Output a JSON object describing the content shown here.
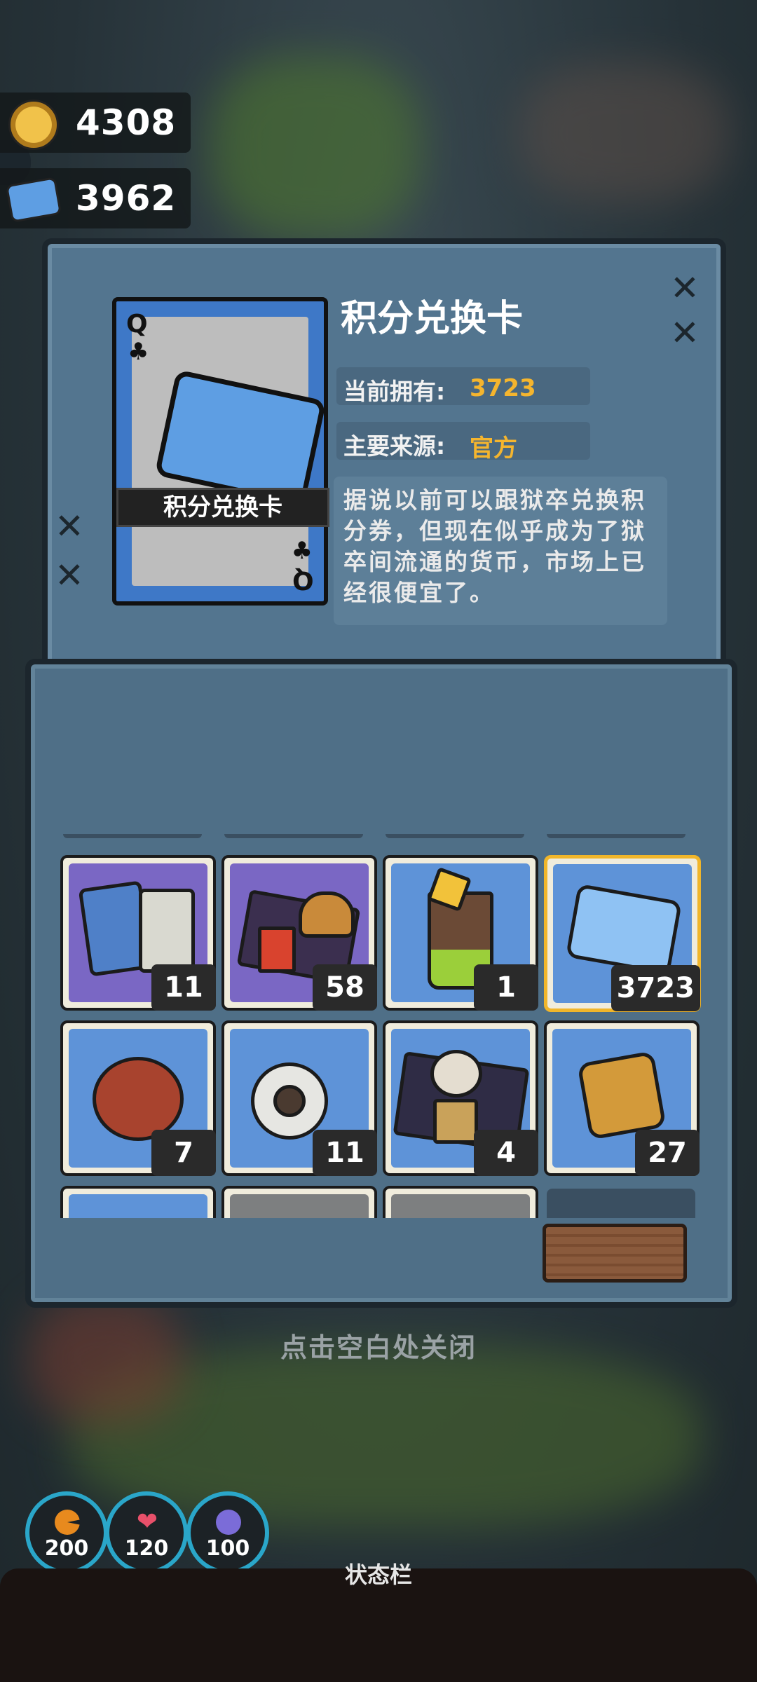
{
  "currency": {
    "coins": "4308",
    "tickets": "3962"
  },
  "item_detail": {
    "card_rank_top": "Q",
    "card_suit": "♣",
    "card_rank_bottom": "Q",
    "card_label": "积分兑换卡",
    "title": "积分兑换卡",
    "owned_label": "当前拥有:",
    "owned_value": "3723",
    "source_label": "主要来源:",
    "source_value": "官方",
    "description": "据说以前可以跟狱卒兑换积分券，但现在似乎成为了狱卒间流通的货币，市场上已经很便宜了。"
  },
  "inventory": [
    {
      "name": "cards-and-pills",
      "count": "11",
      "bg": "#7a67c4"
    },
    {
      "name": "burger-meal",
      "count": "58",
      "bg": "#7a67c4"
    },
    {
      "name": "iced-drink",
      "count": "1",
      "bg": "#5e93d8"
    },
    {
      "name": "points-card",
      "count": "3723",
      "bg": "#5e93d8",
      "selected": true
    },
    {
      "name": "mooncake",
      "count": "7",
      "bg": "#5e93d8"
    },
    {
      "name": "toilet-paper",
      "count": "11",
      "bg": "#5e93d8"
    },
    {
      "name": "breakfast-tray",
      "count": "4",
      "bg": "#5e93d8"
    },
    {
      "name": "pastry",
      "count": "27",
      "bg": "#5e93d8"
    }
  ],
  "close_hint": "点击空白处关闭",
  "stats": [
    {
      "name": "hunger",
      "value": "200",
      "color": "#e88a1e"
    },
    {
      "name": "health",
      "value": "120",
      "color": "#e8506a"
    },
    {
      "name": "sanity",
      "value": "100",
      "color": "#7b6cd8"
    }
  ],
  "statusbar_label": "状态栏"
}
